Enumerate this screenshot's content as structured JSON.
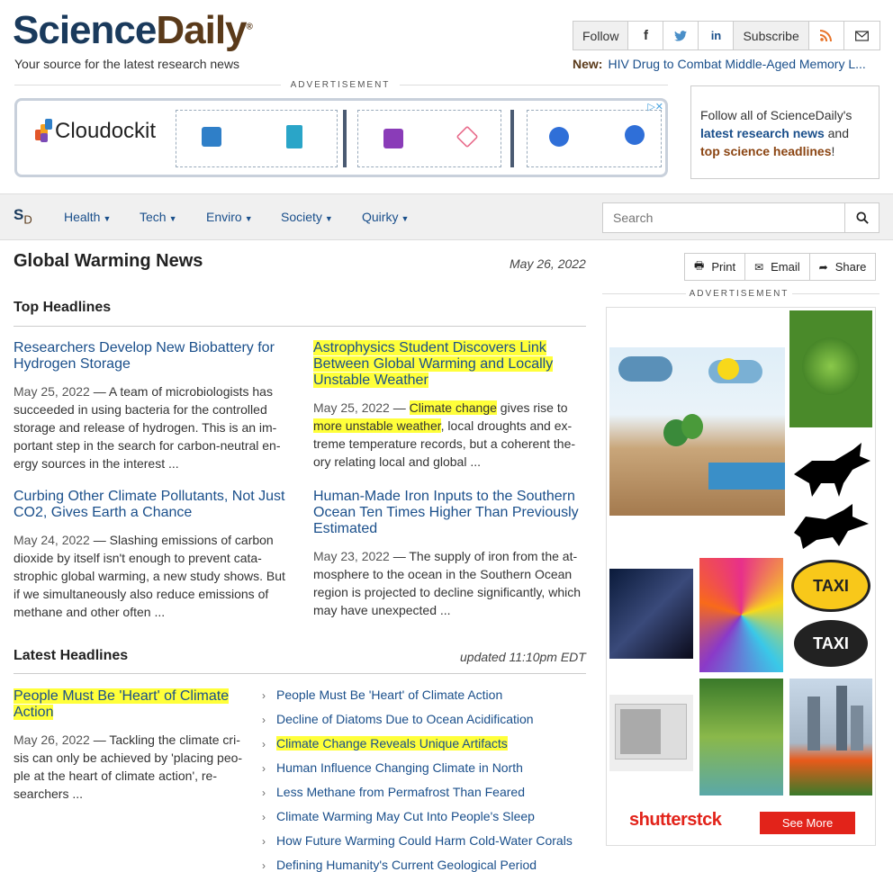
{
  "header": {
    "logo_part1": "Science",
    "logo_part2": "Daily",
    "tagline": "Your source for the latest research news",
    "follow_label": "Follow",
    "subscribe_label": "Subscribe",
    "new_label": "New:",
    "new_headline": "HIV Drug to Combat Middle-Aged Memory L..."
  },
  "ads": {
    "label": "ADVERTISEMENT",
    "banner_brand": "Cloudockit",
    "follow_box": {
      "line1": "Follow all of ScienceDaily's",
      "link1": "latest research news",
      "mid": "and",
      "link2": "top science headlines",
      "end": "!"
    },
    "shutterstock": "shutterstck",
    "see_more": "See More"
  },
  "nav": {
    "logo": "S",
    "logo_sub": "D",
    "items": [
      "Health",
      "Tech",
      "Enviro",
      "Society",
      "Quirky"
    ],
    "search_placeholder": "Search"
  },
  "page": {
    "title": "Global Warming News",
    "date": "May 26, 2022",
    "top_headlines_label": "Top Headlines",
    "latest_headlines_label": "Latest Headlines",
    "updated": "updated 11:10pm EDT"
  },
  "share": {
    "print": "Print",
    "email": "Email",
    "share": "Share"
  },
  "top_stories": [
    {
      "title": "Researchers Develop New Biobattery for Hydrogen Storage",
      "date": "May 25, 2022",
      "summary": "A team of microbiologists has succeeded in using bacteria for the controlled storage and release of hydrogen. This is an im-portant step in the search for carbon-neutral en-ergy sources in the interest ..."
    },
    {
      "title": "Astrophysics Student Discovers Link Between Global Warming and Locally Unstable Weather",
      "date": "May 25, 2022",
      "summary_hl1": "Climate change",
      "summary_mid": "gives rise to",
      "summary_hl2": "more unstable weather",
      "summary_rest": ", local droughts and ex-treme temperature records, but a coherent the-ory relating local and global ..."
    },
    {
      "title": "Curbing Other Climate Pollutants, Not Just CO2, Gives Earth a Chance",
      "date": "May 24, 2022",
      "summary": "Slashing emissions of carbon dioxide by itself isn't enough to prevent cata-strophic global warming, a new study shows. But if we simultaneously also reduce emissions of methane and other often ..."
    },
    {
      "title": "Human-Made Iron Inputs to the Southern Ocean Ten Times Higher Than Previously Estimated",
      "date": "May 23, 2022",
      "summary": "The supply of iron from the at-mosphere to the ocean in the Southern Ocean region is projected to decline significantly, which may have unexpected ..."
    }
  ],
  "latest_story": {
    "title": "People Must Be 'Heart' of Climate Action",
    "date": "May 26, 2022",
    "summary": "Tackling the climate cri-sis can only be achieved by 'placing peo-ple at the heart of climate action', re-searchers ..."
  },
  "latest_list": [
    "People Must Be 'Heart' of Climate Action",
    "Decline of Diatoms Due to Ocean Acidification",
    "Climate Change Reveals Unique Artifacts",
    "Human Influence Changing Climate in North",
    "Less Methane from Permafrost Than Feared",
    "Climate Warming May Cut Into People's Sleep",
    "How Future Warming Could Harm Cold-Water Corals",
    "Defining Humanity's Current Geological Period"
  ],
  "colors": {
    "link": "#1a4f8b",
    "highlight": "#ffff3a",
    "brand_brown": "#5a3a1a",
    "shutterstock_red": "#e2231a"
  }
}
